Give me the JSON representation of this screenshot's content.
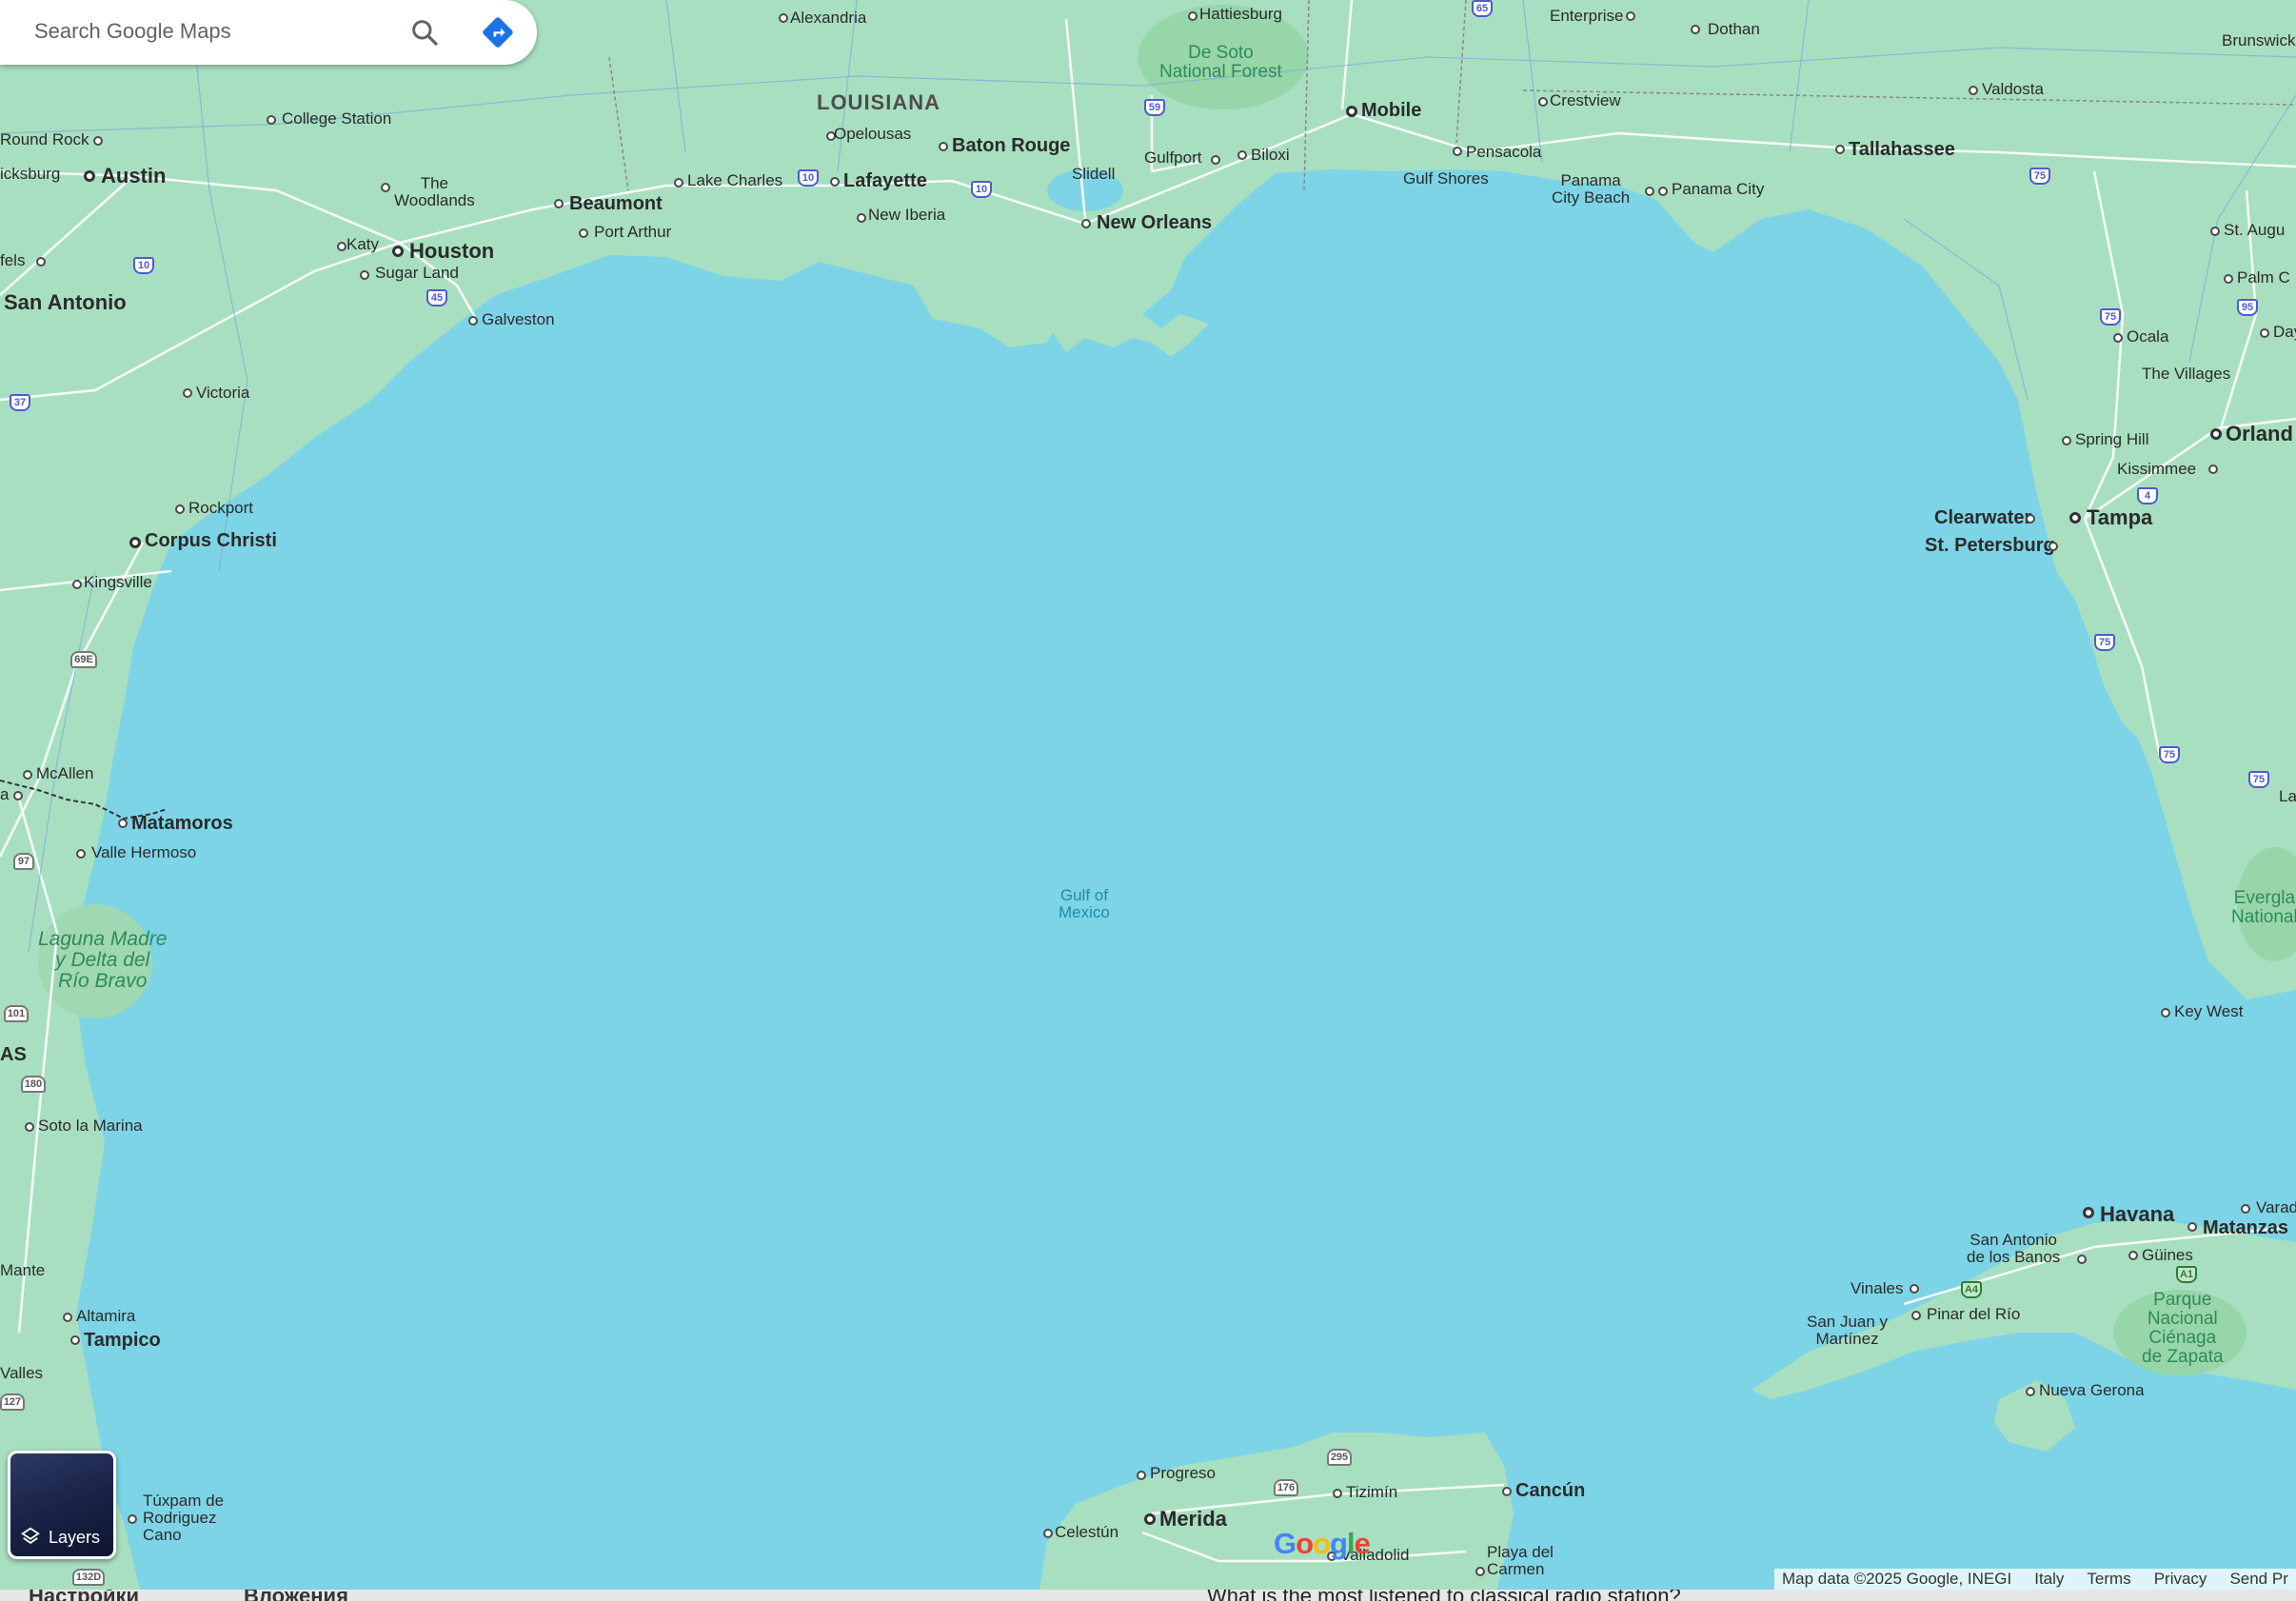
{
  "search": {
    "placeholder": "Search Google Maps",
    "icon": "search-icon",
    "directions_icon": "directions-icon"
  },
  "layers": {
    "label": "Layers",
    "icon": "layers-icon"
  },
  "logo": "Google",
  "footer": {
    "items": [
      "Map data ©2025 Google, INEGI",
      "Italy",
      "Terms",
      "Privacy",
      "Send Pr"
    ]
  },
  "bottom_strip": {
    "left": "Настройки",
    "mid": "Вложения",
    "question": "What is the most listened to classical radio station?"
  },
  "colors": {
    "water": "#7dd4e6",
    "land": "#a9dfc1",
    "road": "#ffffff",
    "shield_interstate": "#4e5bd0",
    "park": "#8fd0a5"
  },
  "map": {
    "regions": {
      "louisiana": "LOUISIANA",
      "gulf": "Gulf of\nMexico",
      "as": "AS"
    },
    "cities": {
      "alexandria": "Alexandria",
      "hattiesburg": "Hattiesburg",
      "enterprise": "Enterprise",
      "dothan": "Dothan",
      "brunswick": "Brunswick",
      "valdosta": "Valdosta",
      "college_station": "College Station",
      "round_rock": "Round Rock",
      "austin": "Austin",
      "icksburg": "icksburg",
      "the_woodlands": "The\nWoodlands",
      "beaumont": "Beaumont",
      "port_arthur": "Port Arthur",
      "lake_charles": "Lake Charles",
      "lafayette": "Lafayette",
      "opelousas": "Opelousas",
      "baton_rouge": "Baton Rouge",
      "new_iberia": "New Iberia",
      "slidell": "Slidell",
      "new_orleans": "New Orleans",
      "gulfport": "Gulfport",
      "biloxi": "Biloxi",
      "mobile": "Mobile",
      "crestview": "Crestview",
      "pensacola": "Pensacola",
      "gulf_shores": "Gulf Shores",
      "panama_city_beach": "Panama\nCity Beach",
      "panama_city": "Panama City",
      "tallahassee": "Tallahassee",
      "st_augustine": "St. Augu",
      "palm_coast": "Palm C",
      "daytona": "Day",
      "ocala": "Ocala",
      "the_villages": "The Villages",
      "spring_hill": "Spring Hill",
      "orlando": "Orland",
      "kissimmee": "Kissimmee",
      "clearwater": "Clearwater",
      "tampa": "Tampa",
      "st_petersburg": "St. Petersburg",
      "katy": "Katy",
      "houston": "Houston",
      "sugar_land": "Sugar Land",
      "galveston": "Galveston",
      "new_braunfels": "fels",
      "san_antonio": "San Antonio",
      "victoria": "Victoria",
      "rockport": "Rockport",
      "corpus_christi": "Corpus Christi",
      "kingsville": "Kingsville",
      "mcallen": "McAllen",
      "reynosa": "a",
      "matamoros": "Matamoros",
      "valle_hermoso": "Valle Hermoso",
      "soto_la_marina": "Soto la Marina",
      "mante": "Mante",
      "altamira": "Altamira",
      "tampico": "Tampico",
      "valles": "Valles",
      "tuxpam": "Túxpam de\nRodriguez\nCano",
      "havana": "Havana",
      "matanzas": "Matanzas",
      "varadero": "Varad",
      "san_antonio_banos": "San Antonio\nde los Banos",
      "guines": "Güines",
      "vinales": "Vinales",
      "pinar_del_rio": "Pinar del Río",
      "san_juan_martinez": "San Juan y\nMartínez",
      "nueva_gerona": "Nueva Gerona",
      "progreso": "Progreso",
      "merida": "Merida",
      "celestun": "Celestún",
      "tizimin": "Tizimín",
      "cancun": "Cancún",
      "valladolid": "Valladolid",
      "playa_del_carmen": "Playa del\nCarmen",
      "key_west": "Key West",
      "la": "La"
    },
    "parks": {
      "de_soto": "De Soto\nNational Forest",
      "laguna_madre": "Laguna Madre\ny Delta del\nRío Bravo",
      "zapata": "Parque\nNacional\nCiénaga\nde Zapata",
      "everglades": "Evergla\nNational"
    },
    "shields": {
      "i10a": "10",
      "i10b": "10",
      "i10c": "10",
      "i45": "45",
      "i37": "37",
      "i59": "59",
      "i65": "65",
      "i75a": "75",
      "i75b": "75",
      "i75c": "75",
      "i75d": "75",
      "i75e": "75",
      "i95": "95",
      "i4": "4",
      "us69e": "69E",
      "mx97": "97",
      "mx101": "101",
      "mx180": "180",
      "mx127": "127",
      "mx132d": "132D",
      "mx176": "176",
      "mx295": "295",
      "a4": "A4",
      "a1": "A1"
    }
  }
}
